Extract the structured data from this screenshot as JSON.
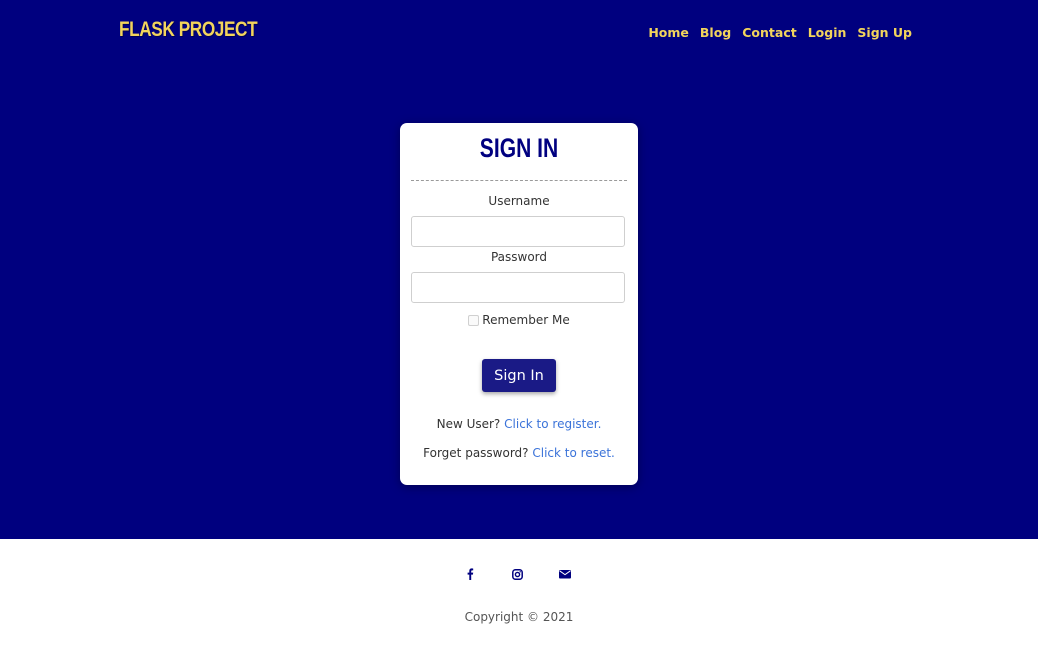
{
  "header": {
    "brand": "FLASK PROJECT",
    "nav": [
      "Home",
      "Blog",
      "Contact",
      "Login",
      "Sign Up"
    ]
  },
  "signin": {
    "title": "SIGN IN",
    "username_label": "Username",
    "password_label": "Password",
    "remember_label": "Remember Me",
    "submit_label": "Sign In",
    "new_user_text": "New User?",
    "register_link": "Click to register.",
    "forgot_text": "Forget password?",
    "reset_link": "Click to reset."
  },
  "footer": {
    "icons": [
      "facebook-icon",
      "instagram-icon",
      "envelope-icon"
    ],
    "copyright": "Copyright © 2021"
  },
  "colors": {
    "hero_bg": "#00007f",
    "brand_yellow": "#f2d45c",
    "button_bg": "#1a1a86",
    "link_blue": "#3b73d9"
  }
}
